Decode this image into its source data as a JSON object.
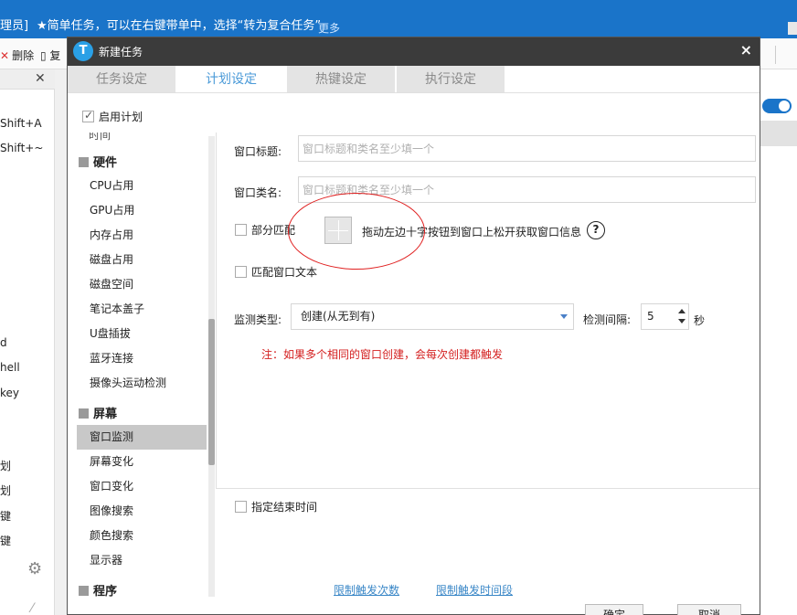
{
  "background": {
    "title_left": "理员]",
    "banner": "★简单任务，可以在右键带单中，选择“转为复合任务”",
    "more": "更多",
    "toolbar": {
      "delete": "删除",
      "copy": "复"
    },
    "left_items": [
      "Shift+A",
      "Shift+~",
      "d",
      "hell",
      "key",
      "划",
      "划",
      "键",
      "键"
    ]
  },
  "dialog": {
    "title": "新建任务",
    "logo": "T",
    "close": "×",
    "tabs": [
      "任务设定",
      "计划设定",
      "热键设定",
      "执行设定"
    ],
    "active_tab": "计划设定",
    "enable_plan": "启用计划"
  },
  "sidebar": {
    "cut_item": "时间",
    "groups": [
      {
        "title": "硬件",
        "items": [
          "CPU占用",
          "GPU占用",
          "内存占用",
          "磁盘占用",
          "磁盘空间",
          "笔记本盖子",
          "U盘插拔",
          "蓝牙连接",
          "摄像头运动检测"
        ]
      },
      {
        "title": "屏幕",
        "items": [
          "窗口监测",
          "屏幕变化",
          "窗口变化",
          "图像搜索",
          "颜色搜索",
          "显示器"
        ]
      },
      {
        "title": "程序",
        "items": []
      }
    ],
    "selected": "窗口监测"
  },
  "form": {
    "window_title_label": "窗口标题:",
    "window_title_placeholder": "窗口标题和类名至少填一个",
    "window_class_label": "窗口类名:",
    "window_class_placeholder": "窗口标题和类名至少填一个",
    "partial_match": "部分匹配",
    "drag_hint": "拖动左边十字按钮到窗口上松开获取窗口信息",
    "help": "?",
    "match_text": "匹配窗口文本",
    "monitor_type_label": "监测类型:",
    "monitor_type_value": "创建(从无到有)",
    "interval_label": "检测间隔:",
    "interval_value": "5",
    "interval_unit": "秒",
    "note": "注：如果多个相同的窗口创建，会每次创建都触发",
    "end_time": "指定结束时间",
    "limit_count": "限制触发次数",
    "limit_period": "限制触发时间段",
    "ok": "确定",
    "cancel": "取消"
  },
  "colors": {
    "accent": "#4a9ad8",
    "warning": "#d42020",
    "titlebar": "#3b3b3b"
  }
}
